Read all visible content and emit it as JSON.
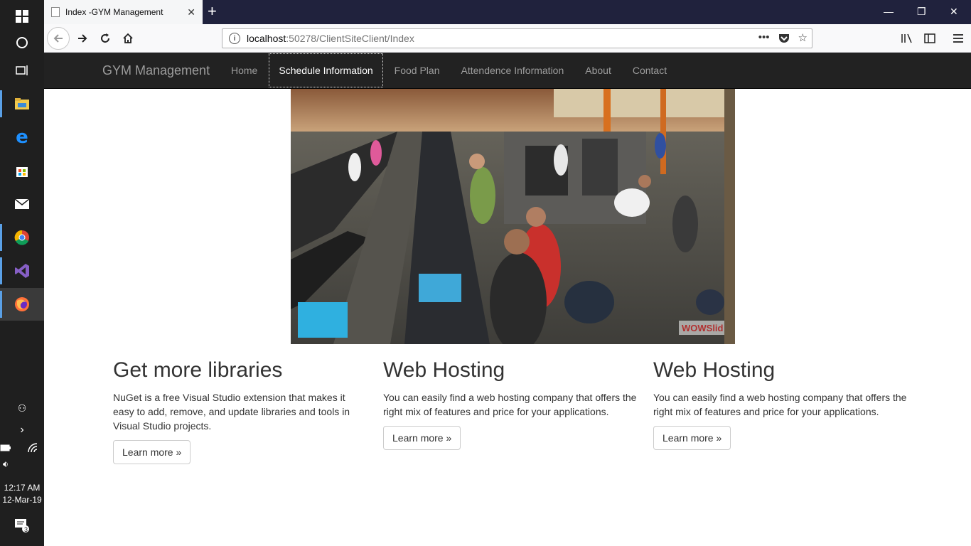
{
  "taskbar": {
    "time": "12:17 AM",
    "date": "12-Mar-19",
    "notification_count": "3",
    "colors": {
      "accent": "#5aa0e6",
      "background": "#1f1f1f"
    }
  },
  "browser": {
    "tab_title": "Index -GYM Management",
    "url_host": "localhost",
    "url_rest": ":50278/ClientSiteClient/Index"
  },
  "site": {
    "brand": "GYM Management",
    "nav": [
      {
        "label": "Home",
        "active": false
      },
      {
        "label": "Schedule Information",
        "active": true
      },
      {
        "label": "Food Plan",
        "active": false
      },
      {
        "label": "Attendence Information",
        "active": false
      },
      {
        "label": "About",
        "active": false
      },
      {
        "label": "Contact",
        "active": false
      }
    ],
    "hero": {
      "watermark": "WOWSlid"
    },
    "columns": [
      {
        "heading": "Get more libraries",
        "text": "NuGet is a free Visual Studio extension that makes it easy to add, remove, and update libraries and tools in Visual Studio projects.",
        "button": "Learn more »"
      },
      {
        "heading": "Web Hosting",
        "text": "You can easily find a web hosting company that offers the right mix of features and price for your applications.",
        "button": "Learn more »"
      },
      {
        "heading": "Web Hosting",
        "text": "You can easily find a web hosting company that offers the right mix of features and price for your applications.",
        "button": "Learn more »"
      }
    ]
  }
}
